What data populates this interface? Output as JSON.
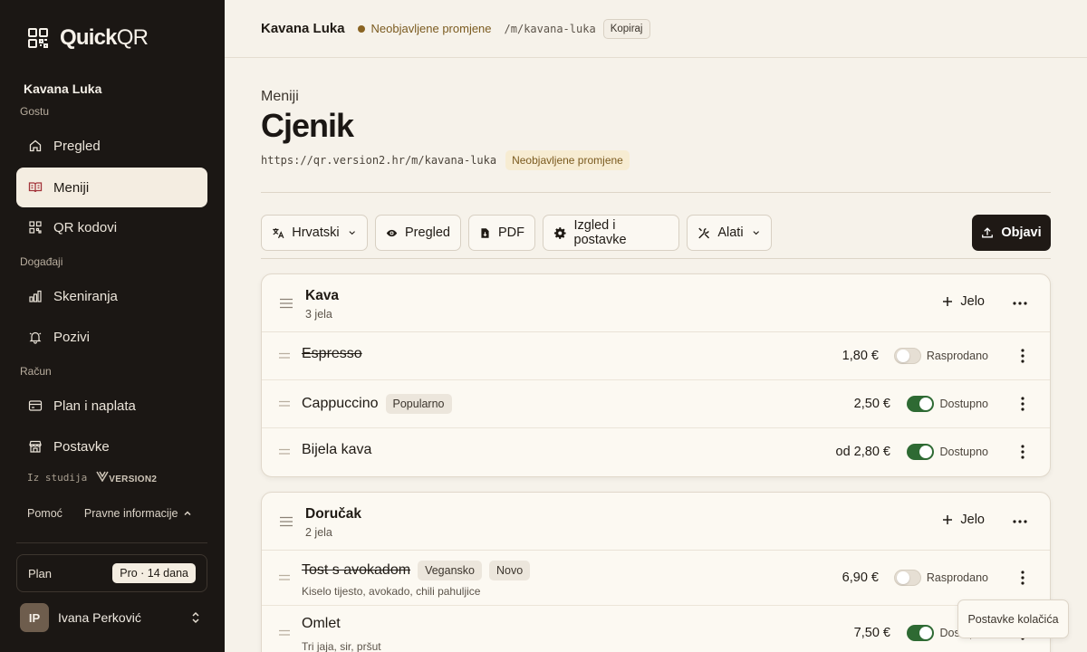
{
  "app": {
    "name_bold": "Quick",
    "name_light": "QR"
  },
  "sidebar": {
    "venue": "Kavana Luka",
    "groups": [
      "Gostu",
      "Događaji",
      "Račun"
    ],
    "items": [
      {
        "label": "Pregled",
        "icon": "home-icon"
      },
      {
        "label": "Meniji",
        "icon": "book-icon",
        "active": true
      },
      {
        "label": "QR kodovi",
        "icon": "qr-icon"
      },
      {
        "label": "Skeniranja",
        "icon": "bar-chart-icon"
      },
      {
        "label": "Pozivi",
        "icon": "bell-icon"
      },
      {
        "label": "Plan i naplata",
        "icon": "credit-card-icon"
      },
      {
        "label": "Postavke",
        "icon": "store-icon"
      }
    ],
    "studio_prefix": "Iz studija",
    "studio_name": "VERSION2",
    "help": "Pomoć",
    "legal": "Pravne informacije",
    "plan_label": "Plan",
    "plan_badge": "Pro · 14 dana",
    "user": {
      "initials": "IP",
      "name": "Ivana Perković"
    }
  },
  "topbar": {
    "venue": "Kavana Luka",
    "status": "Neobjavljene promjene",
    "path": "/m/kavana-luka",
    "copy_label": "Kopiraj"
  },
  "header": {
    "breadcrumb": "Meniji",
    "title": "Cjenik",
    "url": "https://qr.version2.hr/m/kavana-luka",
    "badge": "Neobjavljene promjene"
  },
  "toolbar": {
    "language": "Hrvatski",
    "preview": "Pregled",
    "pdf": "PDF",
    "settings": "Izgled i postavke",
    "tools": "Alati",
    "publish": "Objavi"
  },
  "categories": [
    {
      "name": "Kava",
      "count": "3 jela",
      "add_label": "Jelo",
      "items": [
        {
          "name": "Espresso",
          "price": "1,80 €",
          "status": "Rasprodano",
          "available": false,
          "tags": [],
          "desc": ""
        },
        {
          "name": "Cappuccino",
          "price": "2,50 €",
          "status": "Dostupno",
          "available": true,
          "tags": [
            "Popularno"
          ],
          "desc": ""
        },
        {
          "name": "Bijela kava",
          "price": "od 2,80 €",
          "status": "Dostupno",
          "available": true,
          "tags": [],
          "desc": ""
        }
      ]
    },
    {
      "name": "Doručak",
      "count": "2 jela",
      "add_label": "Jelo",
      "items": [
        {
          "name": "Tost s avokadom",
          "price": "6,90 €",
          "status": "Rasprodano",
          "available": false,
          "tags": [
            "Vegansko",
            "Novo"
          ],
          "desc": "Kiselo tijesto, avokado, chili pahuljice"
        },
        {
          "name": "Omlet",
          "price": "7,50 €",
          "status": "Dostupno",
          "available": true,
          "tags": [],
          "desc": "Tri jaja, sir, pršut"
        }
      ]
    }
  ],
  "cookie": "Postavke kolačića",
  "colors": {
    "sidebar_bg": "#1b1714",
    "accent_dark": "#1f1915",
    "toggle_on": "#2e6a33",
    "unpublished": "#7b5b20"
  }
}
